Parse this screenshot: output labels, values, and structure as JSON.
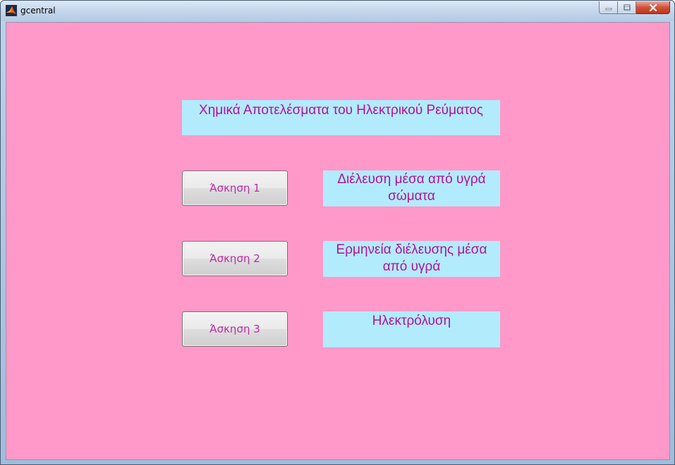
{
  "window": {
    "title": "gcentral"
  },
  "main": {
    "heading": "Χημικά Αποτελέσματα του Ηλεκτρικού Ρεύματος",
    "exercises": [
      {
        "button_label": "Άσκηση 1",
        "description": "Διέλευση μέσα από υγρά σώματα"
      },
      {
        "button_label": "Άσκηση 2",
        "description": "Ερμηνεία διέλευσης μέσα από υγρά"
      },
      {
        "button_label": "Άσκηση 3",
        "description": "Ηλεκτρόλυση"
      }
    ]
  },
  "colors": {
    "background": "#ff99c9",
    "label_background": "#b2ebfc",
    "text": "#b2119c"
  },
  "icons": {
    "app": "matlab-icon",
    "minimize": "minimize-icon",
    "maximize": "maximize-icon",
    "close": "close-icon"
  }
}
